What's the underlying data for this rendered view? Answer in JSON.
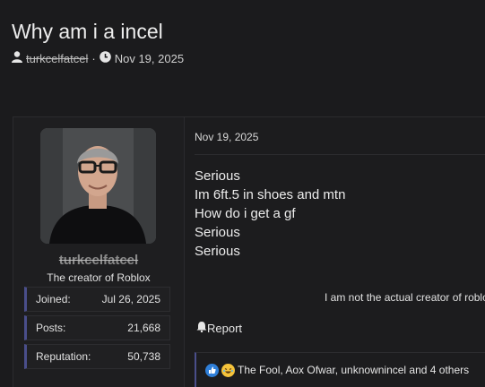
{
  "thread": {
    "title": "Why am i a incel",
    "author": "turkcelfatcel",
    "separator": "·",
    "date": "Nov 19, 2025"
  },
  "post": {
    "user": {
      "username": "turkcelfatcel",
      "title": "The creator of Roblox",
      "stats": [
        {
          "label": "Joined:",
          "value": "Jul 26, 2025"
        },
        {
          "label": "Posts:",
          "value": "21,668"
        },
        {
          "label": "Reputation:",
          "value": "50,738"
        }
      ]
    },
    "date": "Nov 19, 2025",
    "body_lines": [
      "Serious",
      "Im 6ft.5 in shoes and mtn",
      "How do i get a gf",
      "Serious",
      "Serious"
    ],
    "signature": "I am not the actual creator of roblo",
    "report_label": "Report",
    "reactions_text": "The Fool, Aox Ofwar, unknownincel and 4 others"
  },
  "colors": {
    "background": "#1b1b1d",
    "accent": "#4a4e8a",
    "like": "#2f7fd8",
    "haha": "#f5c33b"
  }
}
